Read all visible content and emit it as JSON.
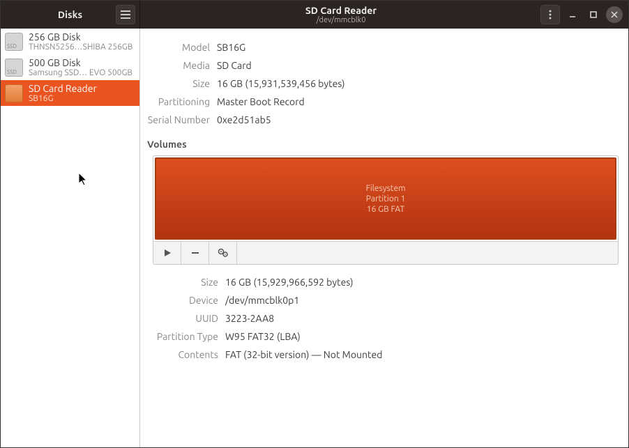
{
  "app": {
    "title": "Disks"
  },
  "window": {
    "title": "SD Card Reader",
    "subtitle": "/dev/mmcblk0"
  },
  "sidebar": {
    "items": [
      {
        "title": "256 GB Disk",
        "subtitle": "THNSN5256…SHIBA 256GB",
        "icon_label": "SSD"
      },
      {
        "title": "500 GB Disk",
        "subtitle": "Samsung SSD… EVO 500GB",
        "icon_label": "SSD"
      },
      {
        "title": "SD Card Reader",
        "subtitle": "SB16G",
        "icon_label": ""
      }
    ]
  },
  "drive": {
    "model_label": "Model",
    "model": "SB16G",
    "media_label": "Media",
    "media": "SD Card",
    "size_label": "Size",
    "size": "16 GB (15,931,539,456 bytes)",
    "partitioning_label": "Partitioning",
    "partitioning": "Master Boot Record",
    "serial_label": "Serial Number",
    "serial": "0xe2d51ab5"
  },
  "volumes_label": "Volumes",
  "partition_vis": {
    "line1": "Filesystem",
    "line2": "Partition 1",
    "line3": "16 GB FAT"
  },
  "volume": {
    "size_label": "Size",
    "size": "16 GB (15,929,966,592 bytes)",
    "device_label": "Device",
    "device": "/dev/mmcblk0p1",
    "uuid_label": "UUID",
    "uuid": "3223-2AA8",
    "ptype_label": "Partition Type",
    "ptype": "W95 FAT32 (LBA)",
    "contents_label": "Contents",
    "contents": "FAT (32-bit version) — Not Mounted"
  }
}
